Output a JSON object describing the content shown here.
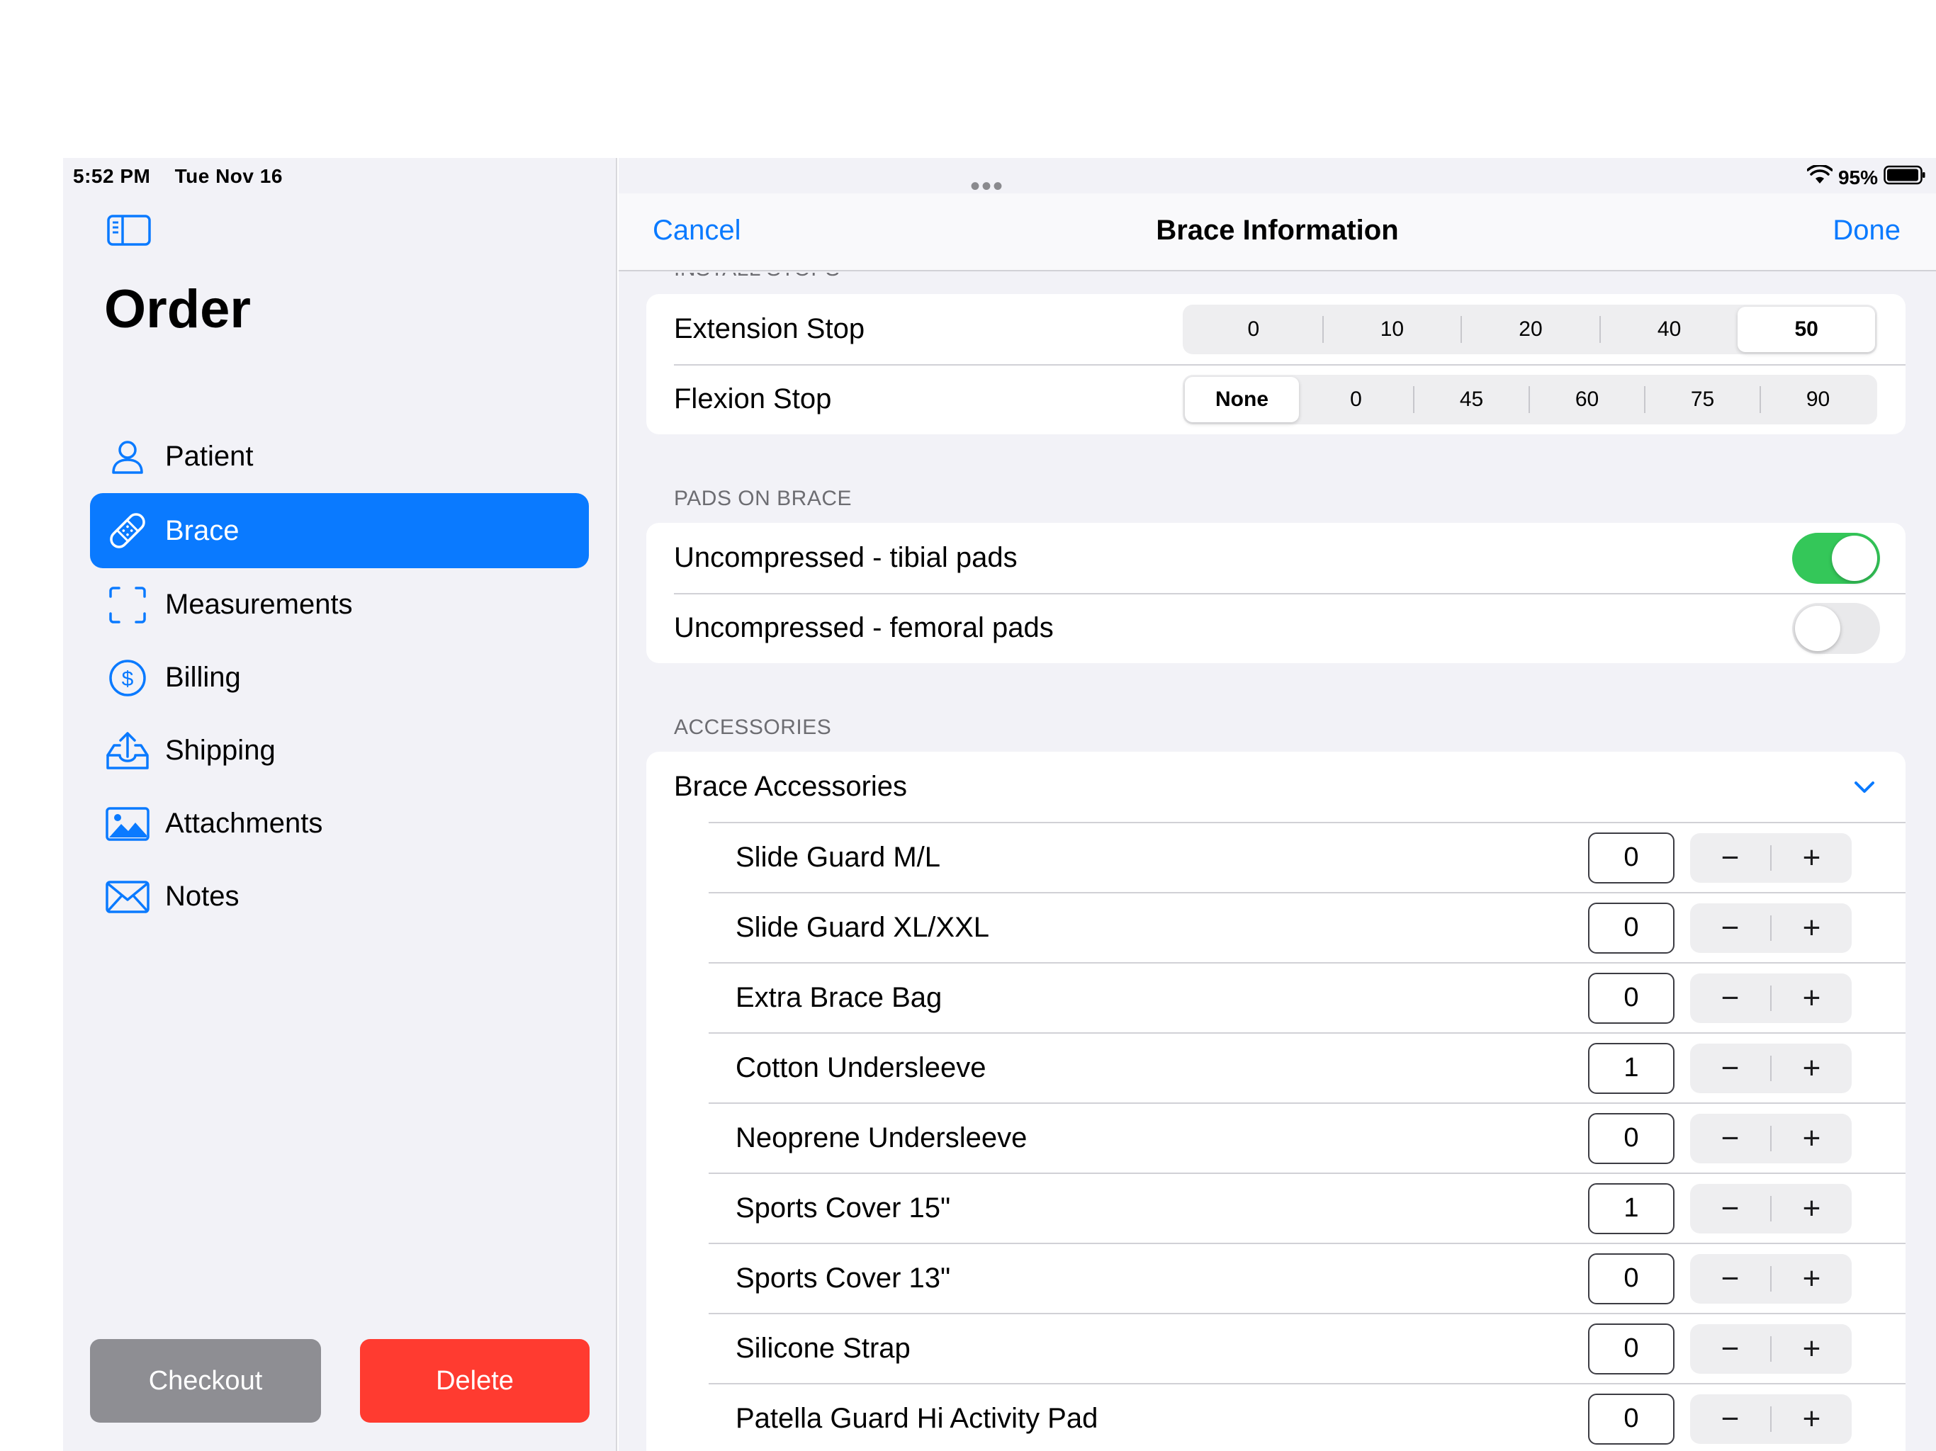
{
  "status": {
    "time": "5:52 PM",
    "date": "Tue Nov 16",
    "battery": "95%"
  },
  "sidebar": {
    "title": "Order",
    "items": [
      {
        "label": "Patient",
        "icon": "person-icon",
        "active": false
      },
      {
        "label": "Brace",
        "icon": "bandage-icon",
        "active": true
      },
      {
        "label": "Measurements",
        "icon": "viewfinder-icon",
        "active": false
      },
      {
        "label": "Billing",
        "icon": "dollar-circle-icon",
        "active": false
      },
      {
        "label": "Shipping",
        "icon": "tray-upload-icon",
        "active": false
      },
      {
        "label": "Attachments",
        "icon": "photo-icon",
        "active": false
      },
      {
        "label": "Notes",
        "icon": "envelope-icon",
        "active": false
      }
    ],
    "checkout_label": "Checkout",
    "delete_label": "Delete"
  },
  "navbar": {
    "cancel_label": "Cancel",
    "title": "Brace Information",
    "done_label": "Done"
  },
  "stops": {
    "header": "INSTALL STOPS",
    "extension": {
      "label": "Extension Stop",
      "options": [
        "0",
        "10",
        "20",
        "40",
        "50"
      ],
      "selected": "50"
    },
    "flexion": {
      "label": "Flexion Stop",
      "options": [
        "None",
        "0",
        "45",
        "60",
        "75",
        "90"
      ],
      "selected": "None"
    }
  },
  "pads": {
    "header": "PADS ON BRACE",
    "items": [
      {
        "label": "Uncompressed - tibial pads",
        "on": true
      },
      {
        "label": "Uncompressed - femoral pads",
        "on": false
      }
    ]
  },
  "accessories": {
    "header": "ACCESSORIES",
    "group_label": "Brace Accessories",
    "items": [
      {
        "label": "Slide Guard M/L",
        "qty": "0"
      },
      {
        "label": "Slide Guard XL/XXL",
        "qty": "0"
      },
      {
        "label": "Extra Brace Bag",
        "qty": "0"
      },
      {
        "label": "Cotton Undersleeve",
        "qty": "1"
      },
      {
        "label": "Neoprene Undersleeve",
        "qty": "0"
      },
      {
        "label": "Sports Cover 15\"",
        "qty": "1"
      },
      {
        "label": "Sports Cover 13\"",
        "qty": "0"
      },
      {
        "label": "Silicone Strap",
        "qty": "0"
      },
      {
        "label": "Patella Guard Hi Activity Pad",
        "qty": "0"
      }
    ],
    "minus_symbol": "−",
    "plus_symbol": "+"
  },
  "colors": {
    "accent": "#0a7aff",
    "toggle_on": "#34c759",
    "delete": "#ff3b30",
    "checkout": "#8e8e93"
  }
}
